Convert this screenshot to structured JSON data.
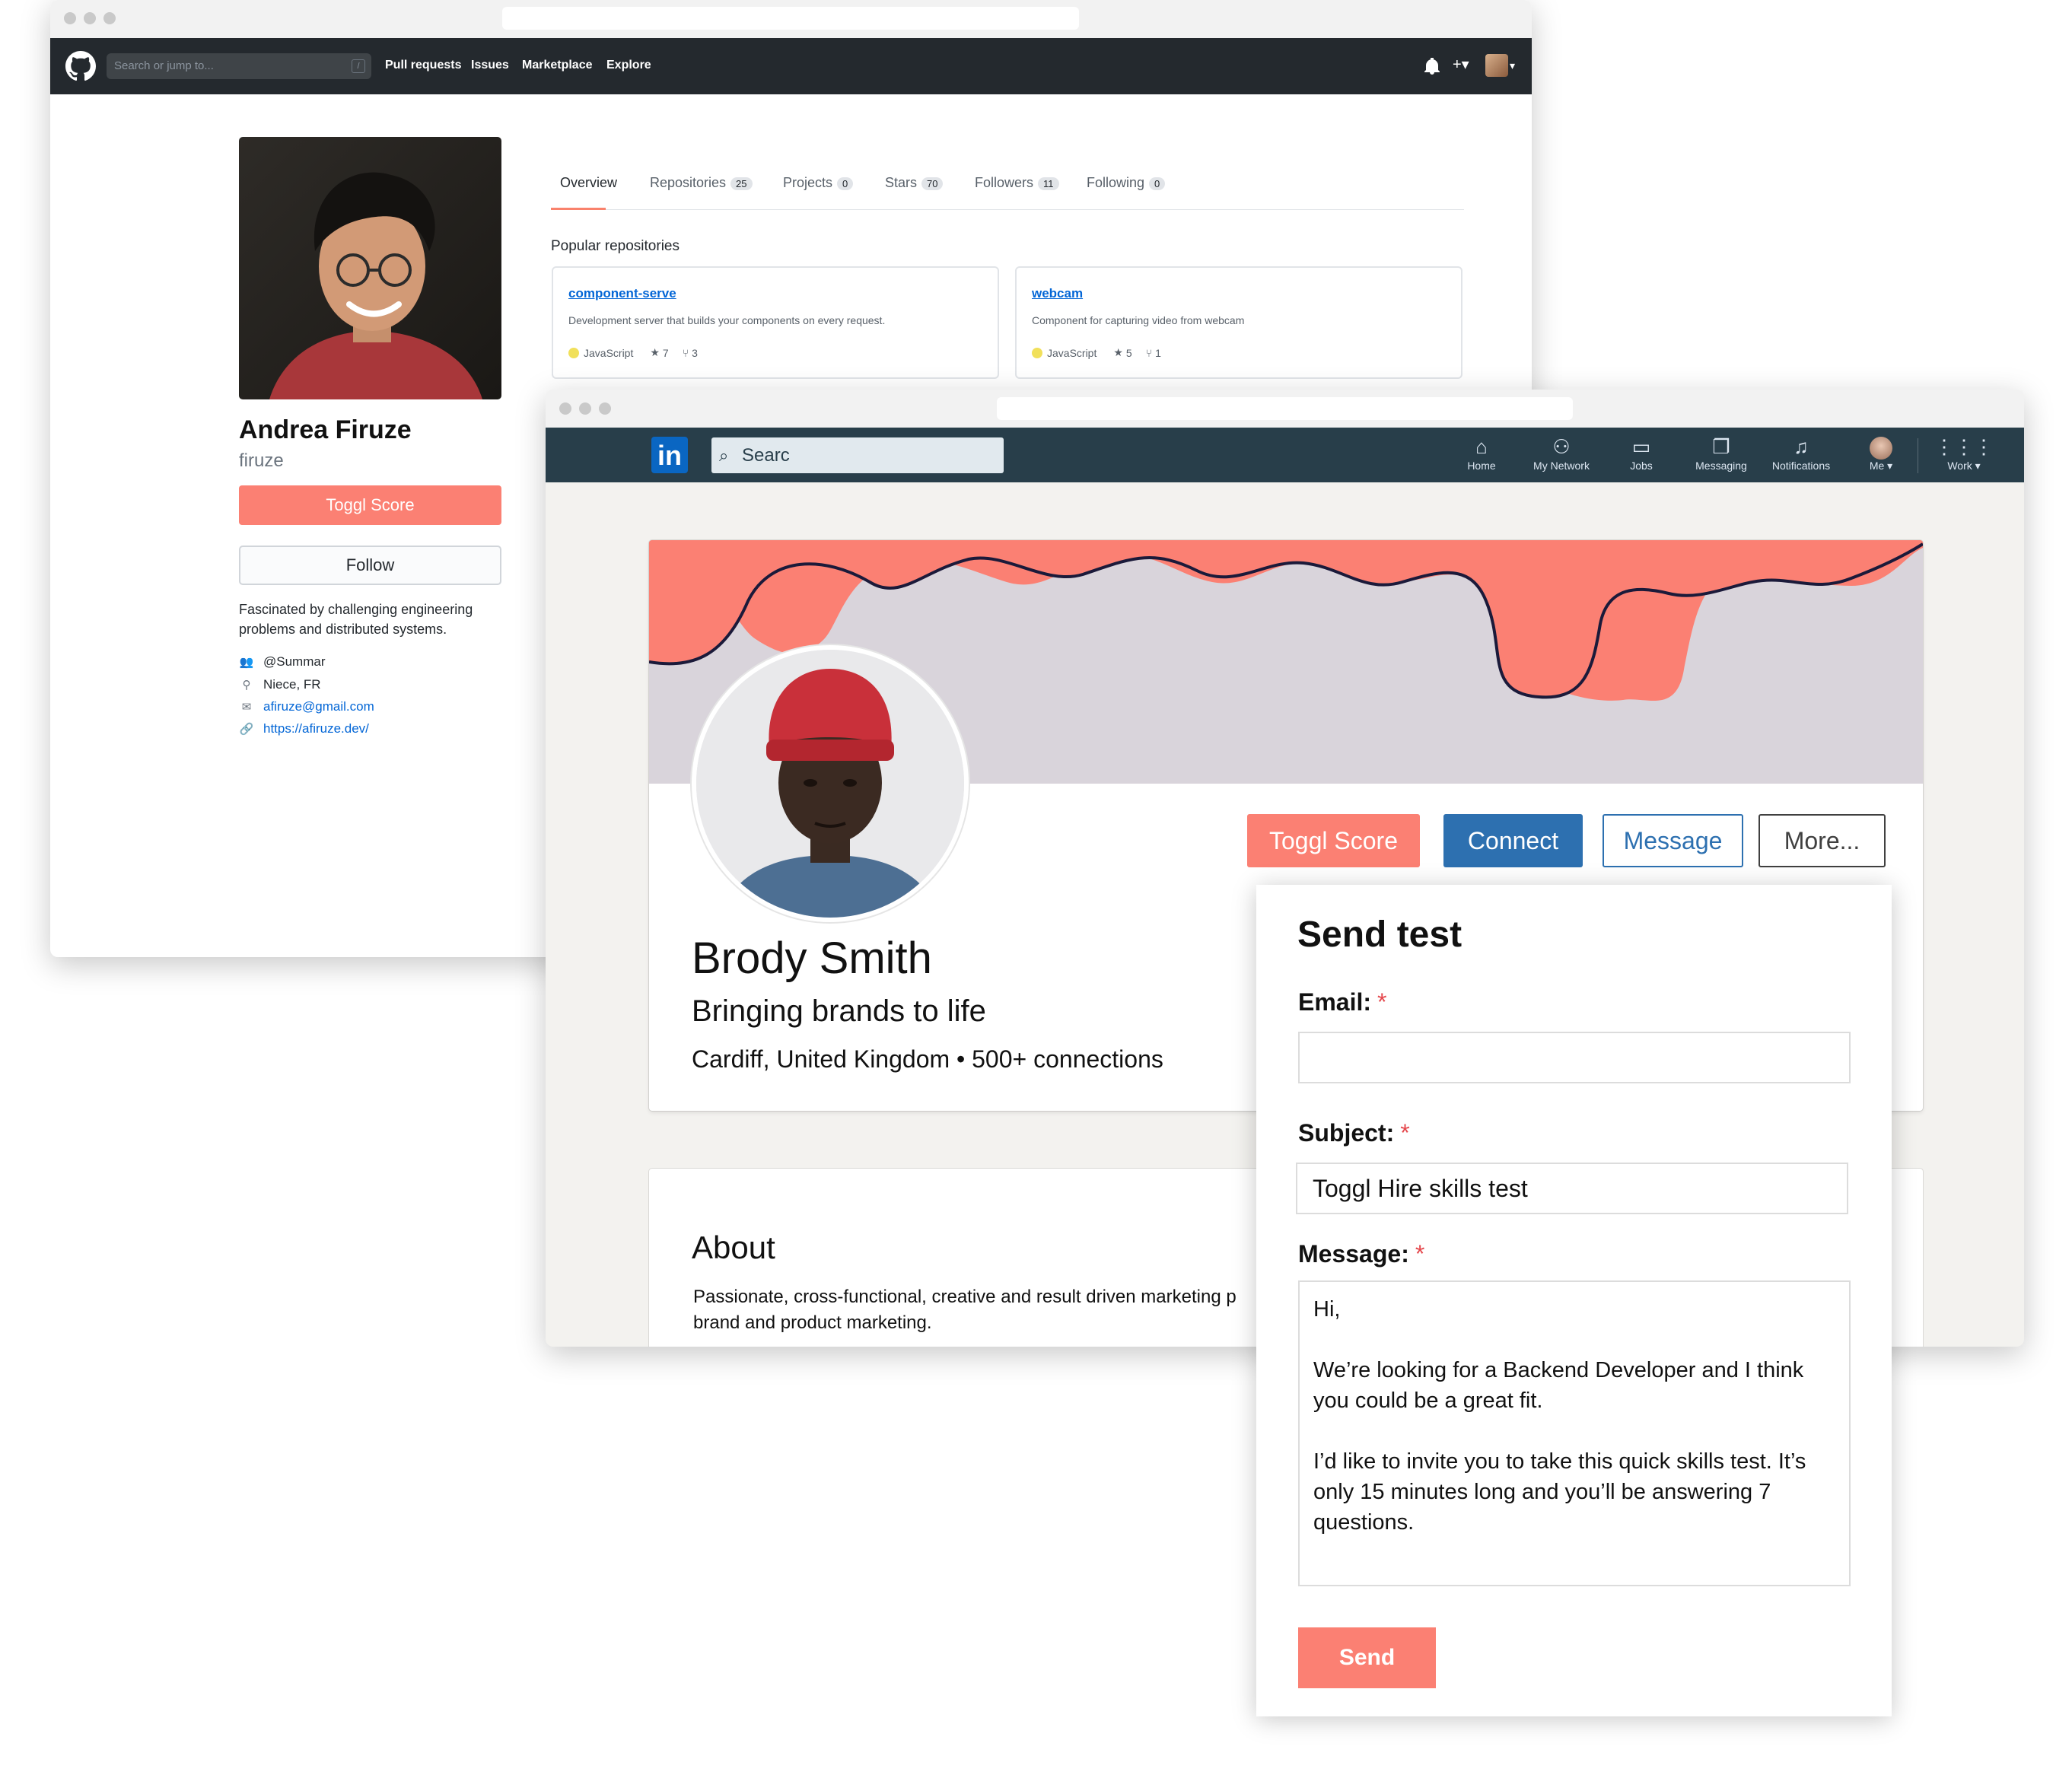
{
  "github": {
    "search_placeholder": "Search or jump to...",
    "search_shortcut": "/",
    "nav": [
      "Pull requests",
      "Issues",
      "Marketplace",
      "Explore"
    ],
    "profile": {
      "name": "Andrea Firuze",
      "username": "firuze",
      "toggl_label": "Toggl Score",
      "follow_label": "Follow",
      "bio": "Fascinated by challenging engineering problems and distributed systems.",
      "org": "@Summar",
      "location": "Niece, FR",
      "email": "afiruze@gmail.com",
      "website": "https://afiruze.dev/"
    },
    "tabs": [
      {
        "label": "Overview",
        "count": ""
      },
      {
        "label": "Repositories",
        "count": "25"
      },
      {
        "label": "Projects",
        "count": "0"
      },
      {
        "label": "Stars",
        "count": "70"
      },
      {
        "label": "Followers",
        "count": "11"
      },
      {
        "label": "Following",
        "count": "0"
      }
    ],
    "popular_title": "Popular repositories",
    "repos": [
      {
        "name": "component-serve",
        "description": "Development server that builds your components on every request.",
        "language": "JavaScript",
        "stars": "7",
        "forks": "3"
      },
      {
        "name": "webcam",
        "description": "Component for capturing video from webcam",
        "language": "JavaScript",
        "stars": "5",
        "forks": "1"
      }
    ]
  },
  "linkedin": {
    "logo": "in",
    "search_value": "Searc",
    "nav": [
      {
        "label": "Home",
        "icon": "home-icon"
      },
      {
        "label": "My Network",
        "icon": "network-icon"
      },
      {
        "label": "Jobs",
        "icon": "briefcase-icon"
      },
      {
        "label": "Messaging",
        "icon": "messaging-icon"
      },
      {
        "label": "Notifications",
        "icon": "bell-icon"
      },
      {
        "label": "Me",
        "icon": "avatar"
      },
      {
        "label": "Work",
        "icon": "grid-icon"
      }
    ],
    "profile": {
      "name": "Brody Smith",
      "headline": "Bringing brands to life",
      "location": "Cardiff, United Kingdom • 500+ connections"
    },
    "buttons": {
      "toggl": "Toggl Score",
      "connect": "Connect",
      "message": "Message",
      "more": "More..."
    },
    "about": {
      "title": "About",
      "line1": "Passionate, cross-functional, creative and result driven marketing p",
      "line2": "brand and product marketing."
    }
  },
  "modal": {
    "title": "Send test",
    "email_label": "Email:",
    "email_value": "",
    "subject_label": "Subject:",
    "subject_value": "Toggl Hire skills test",
    "message_label": "Message:",
    "message_value": "Hi,\n\nWe’re looking for a Backend Developer and I think you could be a great fit.\n\nI’d like to invite you to take this quick skills test. It’s only 15 minutes long and you’ll be answering 7 questions.",
    "required_mark": "*",
    "send_label": "Send"
  },
  "colors": {
    "accent": "#fb8073",
    "github_nav": "#24292e",
    "linkedin_nav": "#283e4a",
    "linkedin_blue": "#2d70b0",
    "banner": "#d9d4db"
  }
}
